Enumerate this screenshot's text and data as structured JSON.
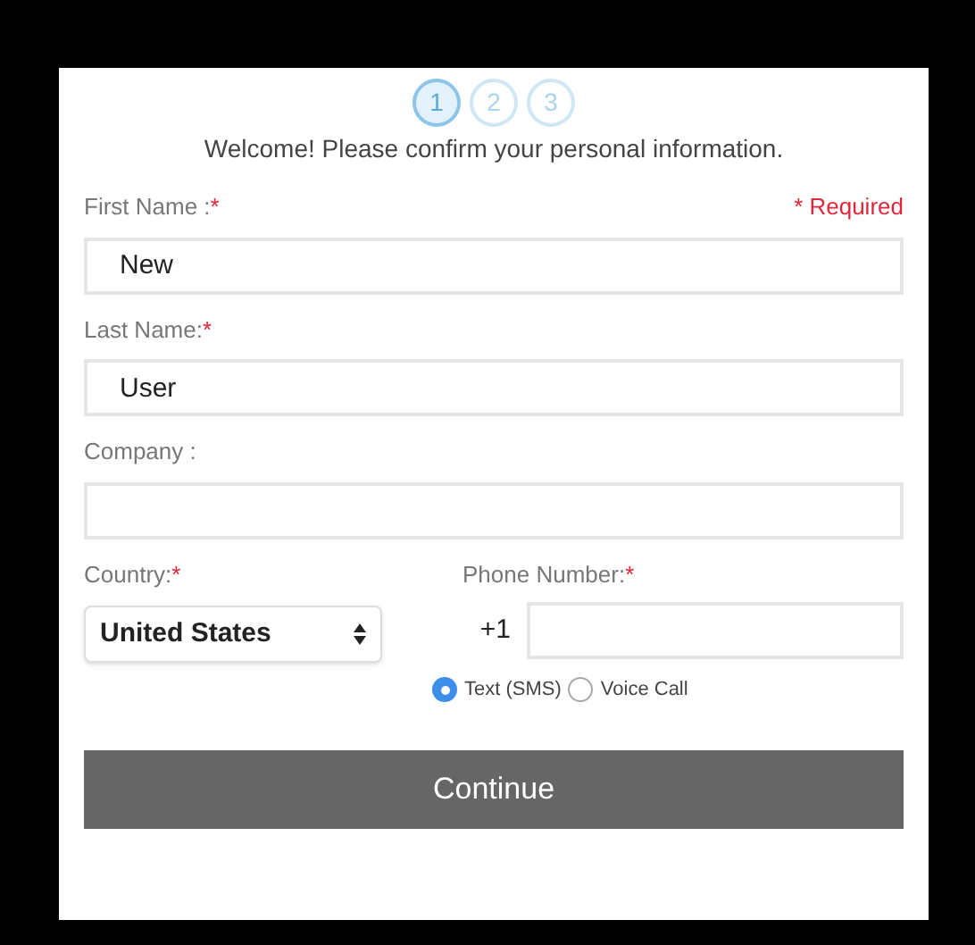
{
  "steps": [
    {
      "label": "1",
      "selected": true
    },
    {
      "label": "2",
      "selected": false
    },
    {
      "label": "3",
      "selected": false
    }
  ],
  "intro": "Welcome! Please confirm your personal information.",
  "required_note": "* Required",
  "fields": [
    {
      "label": "First Name :",
      "required_mark": "*",
      "value": "New"
    },
    {
      "label": "Last Name:",
      "required_mark": "*",
      "value": "User"
    },
    {
      "label": "Company :"
    }
  ],
  "country": {
    "label": "Country:",
    "required_mark": "*",
    "value": "United States"
  },
  "phone": {
    "label": "Phone Number:",
    "required_mark": "*",
    "prefix": "+1"
  },
  "contact_methods": [
    {
      "label": "Text (SMS)",
      "selected": true
    },
    {
      "label": "Voice Call",
      "selected": false
    }
  ],
  "submit": "Continue"
}
